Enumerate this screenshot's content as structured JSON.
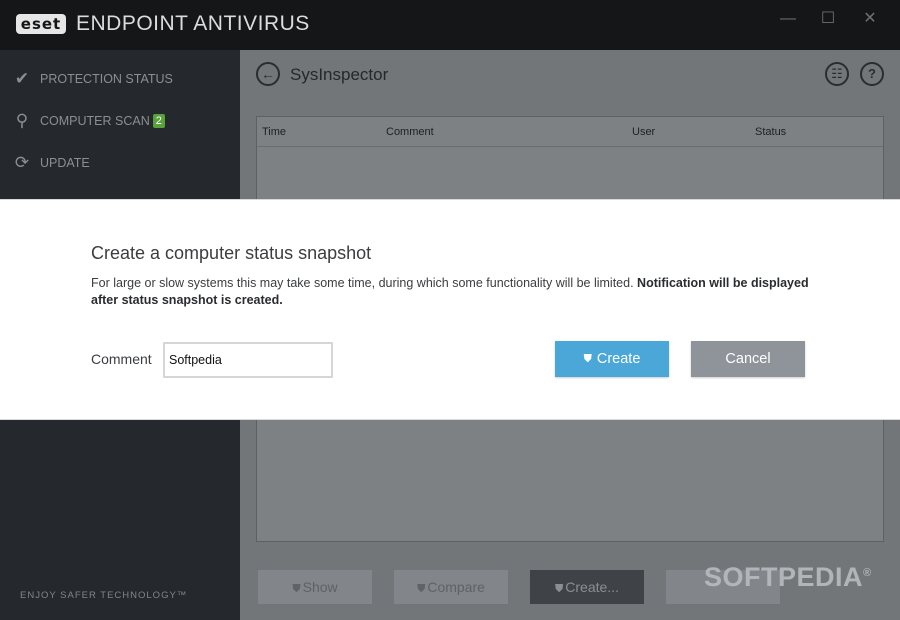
{
  "app": {
    "logo_text": "eset",
    "title": "ENDPOINT ANTIVIRUS",
    "window_controls": {
      "minimize": "—",
      "maximize": "☐",
      "close": "✕"
    }
  },
  "sidebar": {
    "items": [
      {
        "icon": "check-icon",
        "glyph": "✔",
        "label": "PROTECTION STATUS"
      },
      {
        "icon": "search-icon",
        "glyph": "⚲",
        "label": "COMPUTER SCAN",
        "badge": "2"
      },
      {
        "icon": "refresh-icon",
        "glyph": "⟳",
        "label": "UPDATE"
      }
    ],
    "tagline": "ENJOY SAFER TECHNOLOGY™"
  },
  "main": {
    "back_glyph": "←",
    "title": "SysInspector",
    "header_icons": [
      {
        "icon": "list-icon",
        "glyph": "☷"
      },
      {
        "icon": "help-icon",
        "glyph": "?"
      }
    ],
    "table": {
      "columns": [
        "Time",
        "Comment",
        "User",
        "Status"
      ],
      "rows": []
    },
    "buttons": [
      {
        "label": "Show",
        "enabled": false
      },
      {
        "label": "Compare",
        "enabled": false
      },
      {
        "label": "Create...",
        "enabled": true
      }
    ]
  },
  "watermark": {
    "text": "SOFTPEDIA",
    "mark": "®"
  },
  "dialog": {
    "title": "Create a computer status snapshot",
    "description": "For large or slow systems this may take some time, during which some functionality will be limited.",
    "description_bold": "Notification will be displayed after status snapshot is created.",
    "comment_label": "Comment",
    "comment_value": "Softpedia",
    "create_label": "Create",
    "cancel_label": "Cancel"
  },
  "colors": {
    "accent": "#4aa7d8",
    "badge": "#59a13b",
    "sidebar": "#25292d"
  }
}
